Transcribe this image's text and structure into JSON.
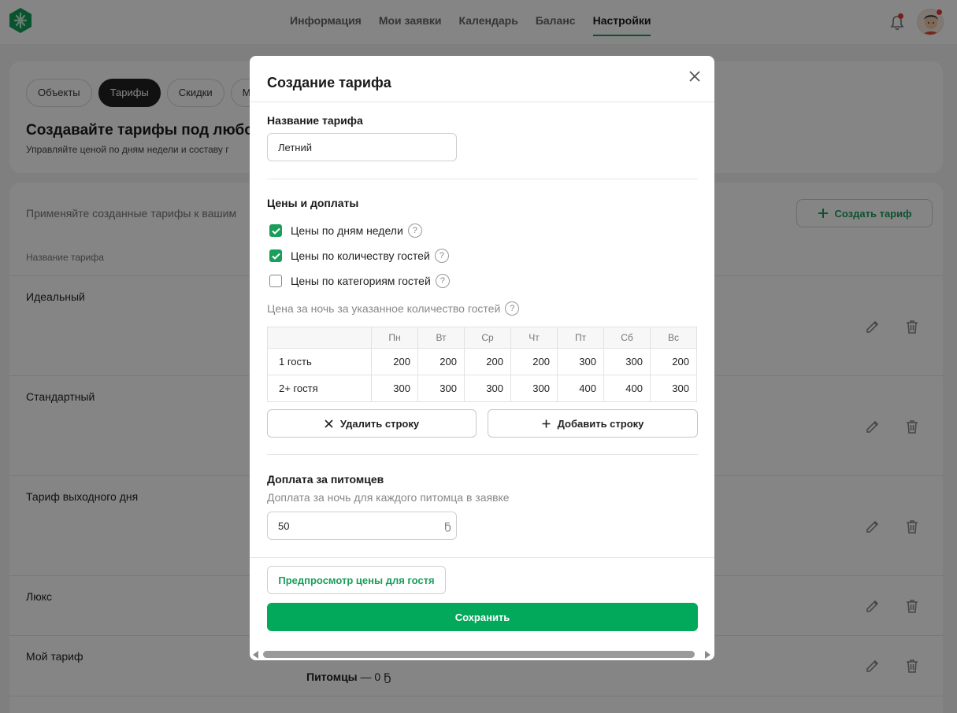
{
  "nav": {
    "items": [
      {
        "label": "Информация",
        "active": false
      },
      {
        "label": "Мои заявки",
        "active": false
      },
      {
        "label": "Календарь",
        "active": false
      },
      {
        "label": "Баланс",
        "active": false
      },
      {
        "label": "Настройки",
        "active": true
      }
    ]
  },
  "settings": {
    "tabs": [
      "Объекты",
      "Тарифы",
      "Скидки",
      "М"
    ],
    "active_tab": "Тарифы",
    "heading": "Создавайте тарифы под любой",
    "subheading": "Управляйте ценой по дням недели и составу г"
  },
  "tariffs": {
    "apply_text": "Применяйте созданные тарифы к вашим",
    "create_button": "Создать тариф",
    "column_name": "Название тарифа",
    "rows": [
      {
        "name": "Идеальный",
        "extra": ""
      },
      {
        "name": "Стандартный",
        "extra": ""
      },
      {
        "name": "Тариф выходного дня",
        "extra": ""
      },
      {
        "name": "Люкс",
        "extra": ""
      },
      {
        "name": "Мой тариф",
        "extra_bold": "Питомцы",
        "extra": " — 0 Ҕ"
      }
    ]
  },
  "modal": {
    "title": "Создание тарифа",
    "name_label": "Название тарифа",
    "name_value": "Летний",
    "prices_label": "Цены и доплаты",
    "checkboxes": [
      {
        "label": "Цены по дням недели",
        "checked": true
      },
      {
        "label": "Цены по количеству гостей",
        "checked": true
      },
      {
        "label": "Цены по категориям гостей",
        "checked": false
      }
    ],
    "table_caption": "Цена за ночь за указанное количество гостей",
    "table": {
      "days": [
        "Пн",
        "Вт",
        "Ср",
        "Чт",
        "Пт",
        "Сб",
        "Вс"
      ],
      "rows": [
        {
          "label": "1 гость",
          "values": [
            "200",
            "200",
            "200",
            "200",
            "300",
            "300",
            "200"
          ]
        },
        {
          "label": "2+ гостя",
          "values": [
            "300",
            "300",
            "300",
            "300",
            "400",
            "400",
            "300"
          ]
        }
      ]
    },
    "delete_row": "Удалить строку",
    "add_row": "Добавить строку",
    "pets_label": "Доплата за питомцев",
    "pets_desc": "Доплата за ночь для каждого питомца в заявке",
    "pets_value": "50",
    "currency": "Ҕ",
    "preview_button": "Предпросмотр цены для гостя",
    "save_button": "Сохранить"
  },
  "colors": {
    "accent": "#03a95a",
    "accent_text": "#1a9e5c",
    "overlay": "rgba(0,0,0,0.48)"
  }
}
